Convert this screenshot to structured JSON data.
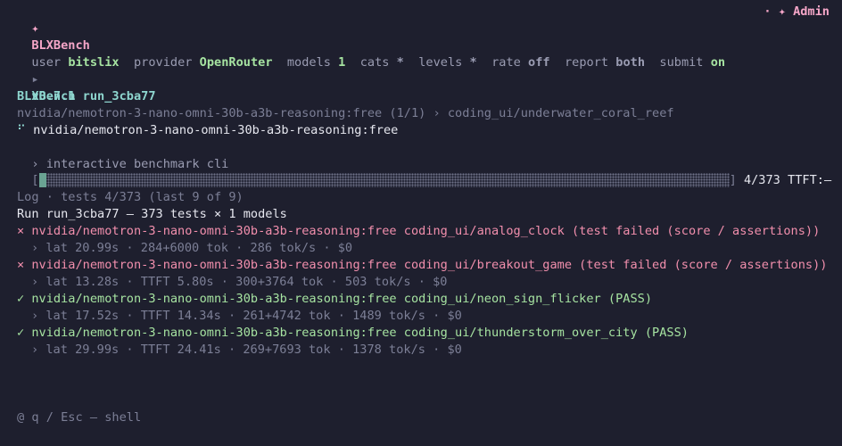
{
  "header": {
    "logo_glyph": "✦",
    "app_name": "BLXBench",
    "version_glyph": "▸",
    "version": "v0.7.1",
    "separator": "·",
    "subtitle": "› interactive benchmark cli",
    "user_badge": "· ✦ Admin"
  },
  "settings": [
    {
      "key": "user",
      "value": "bitslix",
      "color": "green"
    },
    {
      "key": "provider",
      "value": "OpenRouter",
      "color": "green"
    },
    {
      "key": "models",
      "value": "1",
      "color": "green"
    },
    {
      "key": "cats",
      "value": "*",
      "color": "muted"
    },
    {
      "key": "levels",
      "value": "*",
      "color": "muted"
    },
    {
      "key": "rate",
      "value": "off",
      "color": "muted"
    },
    {
      "key": "report",
      "value": "both",
      "color": "muted"
    },
    {
      "key": "submit",
      "value": "on",
      "color": "green"
    }
  ],
  "run": {
    "title": "BLXBench run_3cba77",
    "path": "nvidia/nemotron-3-nano-omni-30b-a3b-reasoning:free (1/1) › coding_ui/underwater_coral_reef",
    "spinner": "⠋",
    "model": "nvidia/nemotron-3-nano-omni-30b-a3b-reasoning:free"
  },
  "progress": {
    "completed": 4,
    "total": 373,
    "status": "4/373 TTFT:—"
  },
  "log": {
    "header": "Log · tests 4/373 (last 9 of 9)",
    "summary": "Run run_3cba77 — 373 tests × 1 models",
    "entries": [
      {
        "icon": "×",
        "status": "fail",
        "text": "nvidia/nemotron-3-nano-omni-30b-a3b-reasoning:free coding_ui/analog_clock (test failed (score / assertions))",
        "detail": "› lat 20.99s · 284+6000 tok · 286 tok/s · $0"
      },
      {
        "icon": "×",
        "status": "fail",
        "text": "nvidia/nemotron-3-nano-omni-30b-a3b-reasoning:free coding_ui/breakout_game (test failed (score / assertions))",
        "detail": "› lat 13.28s · TTFT 5.80s · 300+3764 tok · 503 tok/s · $0"
      },
      {
        "icon": "✓",
        "status": "pass",
        "text": "nvidia/nemotron-3-nano-omni-30b-a3b-reasoning:free coding_ui/neon_sign_flicker (PASS)",
        "detail": "› lat 17.52s · TTFT 14.34s · 261+4742 tok · 1489 tok/s · $0"
      },
      {
        "icon": "✓",
        "status": "pass",
        "text": "nvidia/nemotron-3-nano-omni-30b-a3b-reasoning:free coding_ui/thunderstorm_over_city (PASS)",
        "detail": "› lat 29.99s · TTFT 24.41s · 269+7693 tok · 1378 tok/s · $0"
      }
    ]
  },
  "footer": {
    "hint": "@ q / Esc — shell"
  },
  "colors": {
    "background": "#1e1f2e",
    "accent_pink": "#f5a6c8",
    "accent_teal": "#8ed6cf",
    "pass_green": "#a6e3a1",
    "fail_red": "#f28fad",
    "progress_fill": "#6aa393"
  }
}
